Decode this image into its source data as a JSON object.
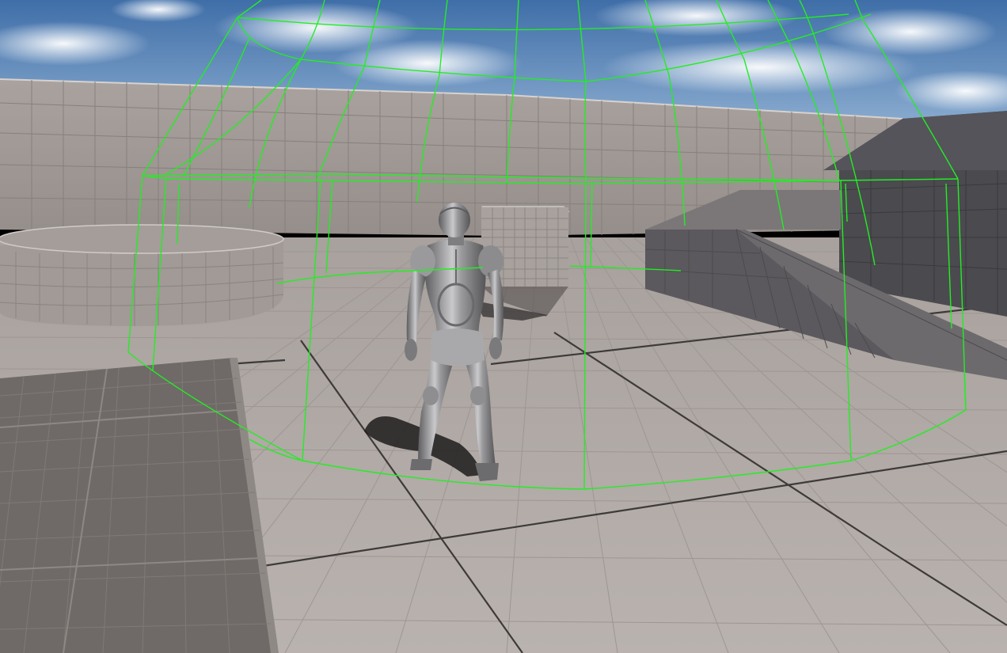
{
  "scene": {
    "kind": "3d-game-viewport",
    "environment": "third-person-template-arena",
    "elements": [
      "sky",
      "perimeter-wall",
      "grid-floor",
      "cylinder-platform",
      "cube-block",
      "ramp",
      "raised-floor-slab",
      "mannequin-character",
      "collision-sphere-wireframe"
    ],
    "wireframe_color": "#22ee22",
    "surface_color": "#b5aeaa",
    "sky_color": "#4f7fb8"
  }
}
